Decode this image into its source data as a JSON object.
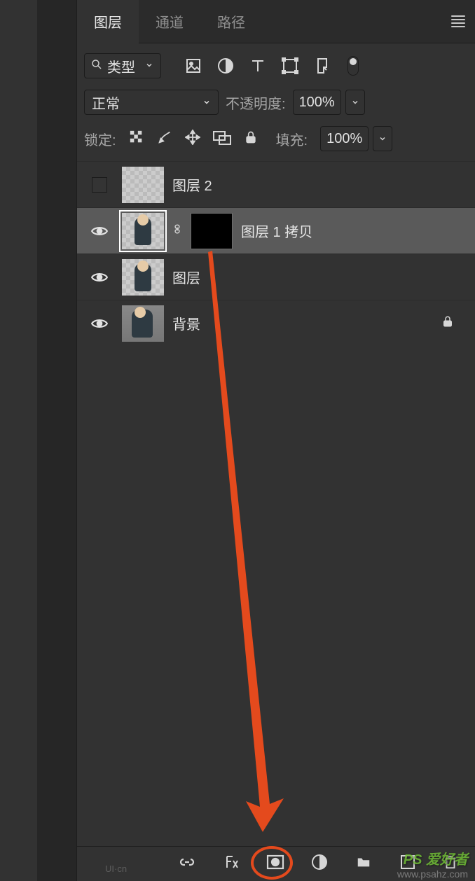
{
  "tabs": {
    "layers": "图层",
    "channels": "通道",
    "paths": "路径"
  },
  "filter": {
    "kind_label": "类型"
  },
  "blend": {
    "mode": "正常",
    "opacity_label": "不透明度:",
    "opacity_value": "100%"
  },
  "lock": {
    "label": "锁定:",
    "fill_label": "填充:",
    "fill_value": "100%"
  },
  "layers": [
    {
      "name": "图层 2",
      "visible": false,
      "selected": false,
      "thumb": "checker",
      "mask": false,
      "locked": false
    },
    {
      "name": "图层 1 拷贝",
      "visible": true,
      "selected": true,
      "thumb": "person",
      "mask": true,
      "locked": false
    },
    {
      "name": "图层",
      "visible": true,
      "selected": false,
      "thumb": "person",
      "mask": false,
      "locked": false
    },
    {
      "name": "背景",
      "visible": true,
      "selected": false,
      "thumb": "photo",
      "mask": false,
      "locked": true
    }
  ],
  "watermark": {
    "text": "PS 爱好者",
    "url": "www.psahz.com"
  },
  "uicn": "UI·cn"
}
